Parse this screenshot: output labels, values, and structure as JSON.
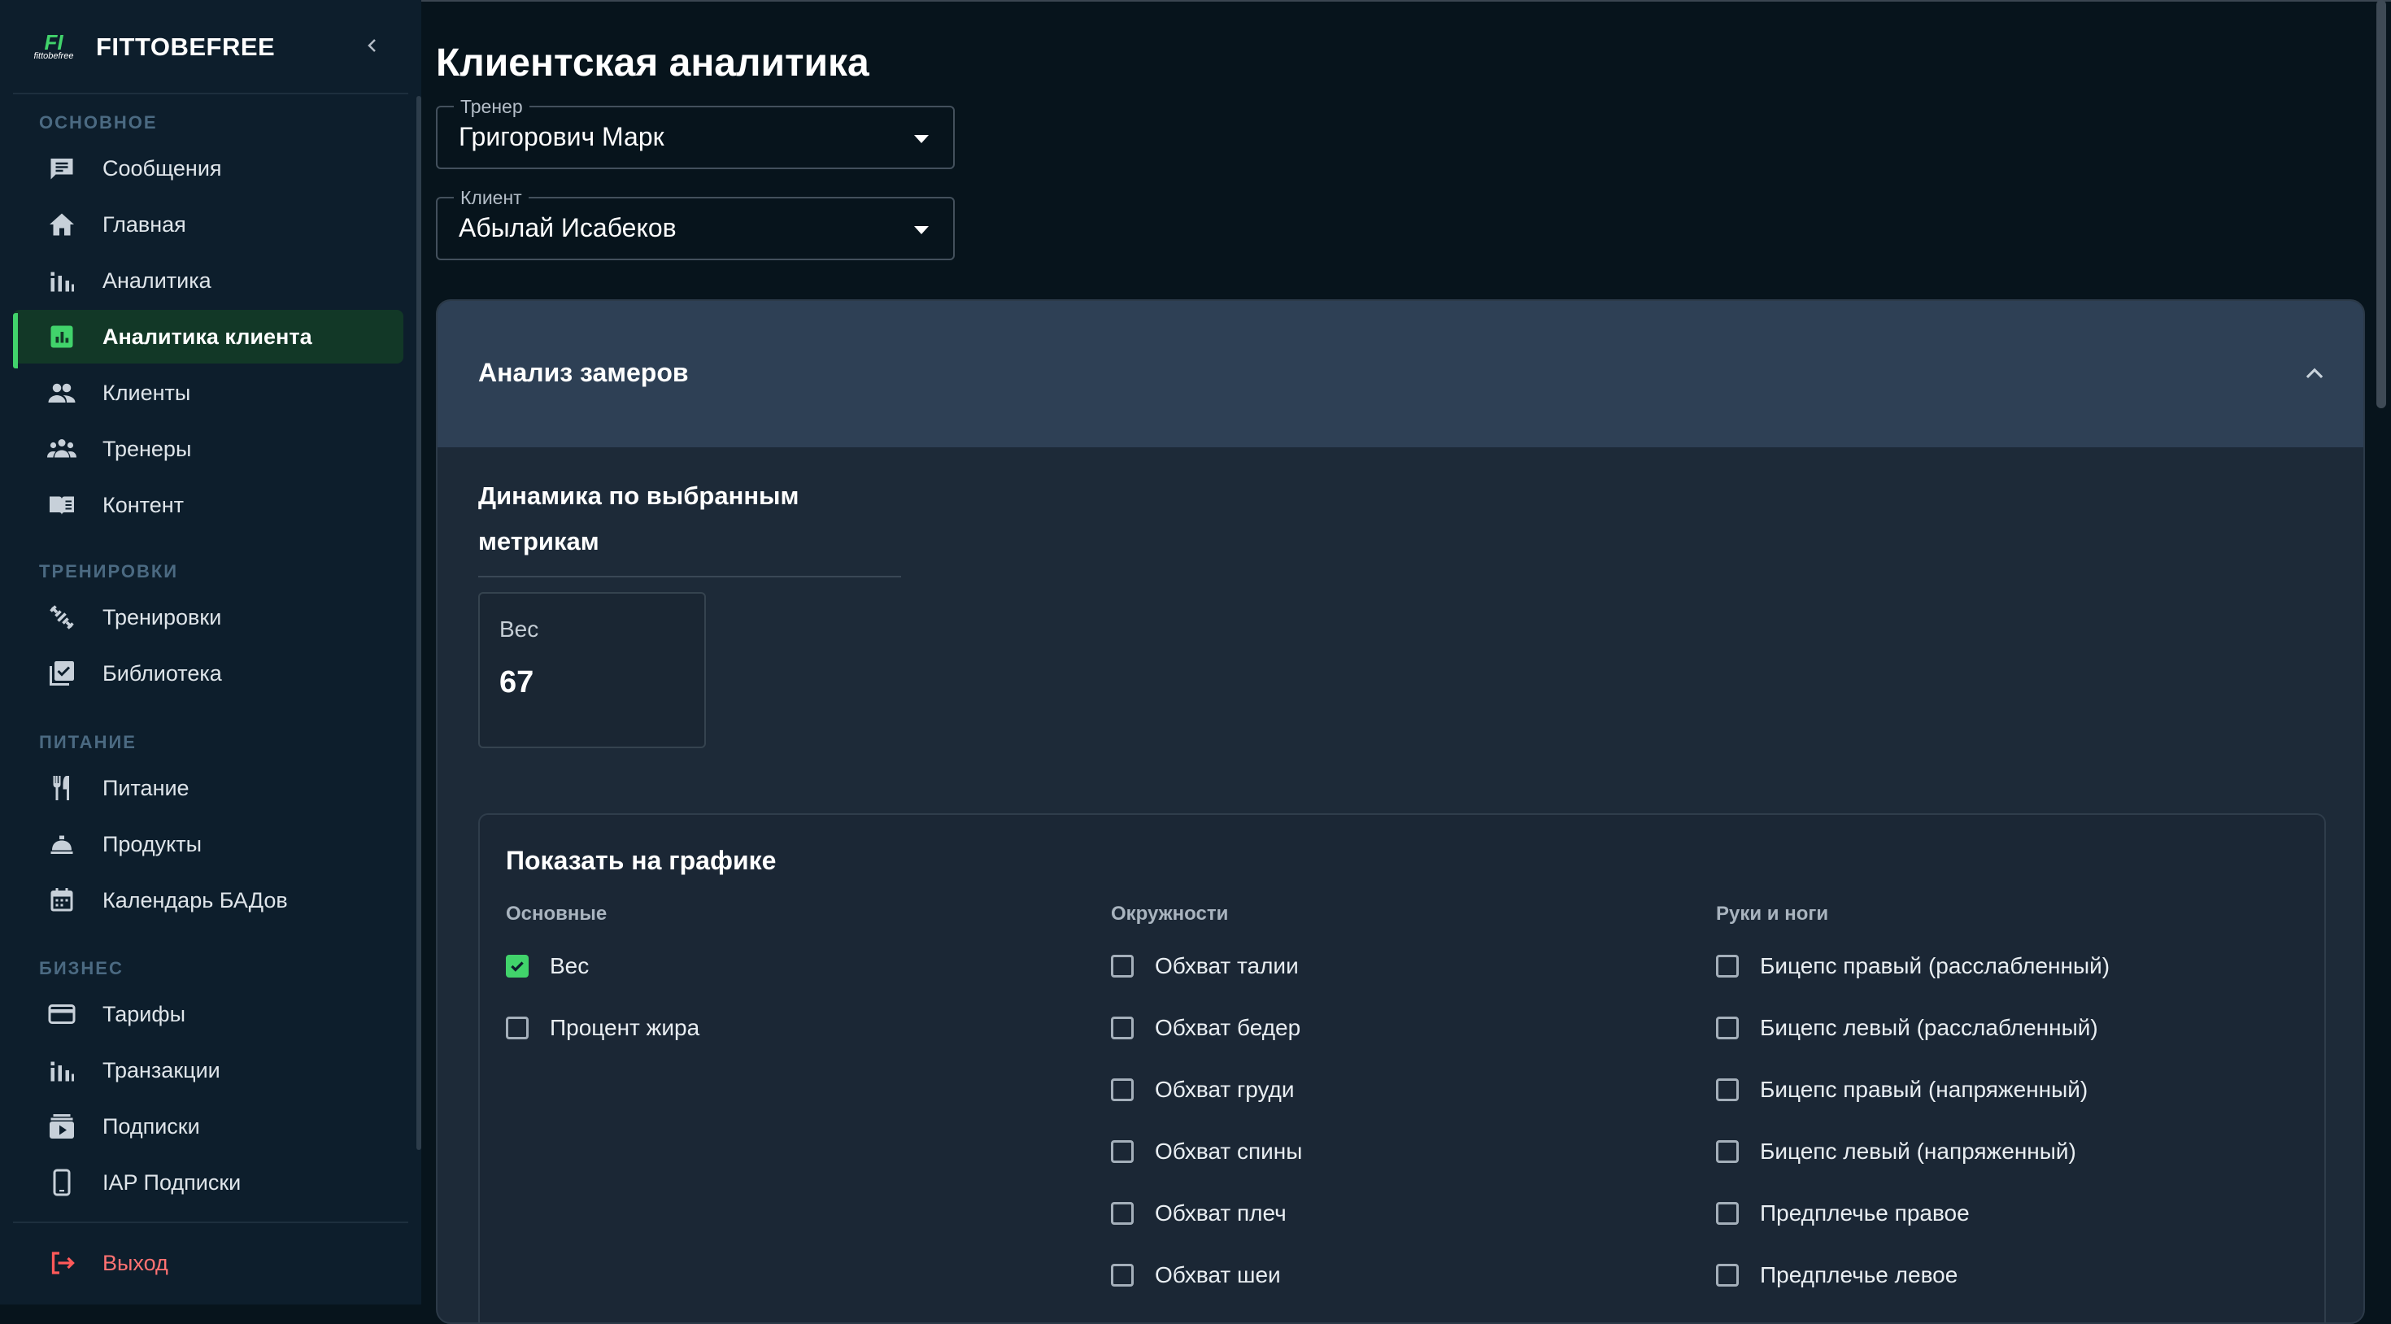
{
  "brand": {
    "logo_mark": "FI",
    "logo_sub": "fittobefree",
    "name": "FITTOBEFREE"
  },
  "sidebar": {
    "sections": [
      {
        "title": "ОСНОВНОЕ",
        "items": [
          {
            "label": "Сообщения",
            "icon": "message-icon"
          },
          {
            "label": "Главная",
            "icon": "home-icon"
          },
          {
            "label": "Аналитика",
            "icon": "bar-chart-icon"
          },
          {
            "label": "Аналитика клиента",
            "icon": "analytics-icon",
            "active": true
          },
          {
            "label": "Клиенты",
            "icon": "people-icon"
          },
          {
            "label": "Тренеры",
            "icon": "groups-icon"
          },
          {
            "label": "Контент",
            "icon": "book-icon"
          }
        ]
      },
      {
        "title": "ТРЕНИРОВКИ",
        "items": [
          {
            "label": "Тренировки",
            "icon": "dumbbell-icon"
          },
          {
            "label": "Библиотека",
            "icon": "library-icon"
          }
        ]
      },
      {
        "title": "ПИТАНИЕ",
        "items": [
          {
            "label": "Питание",
            "icon": "fork-knife-icon"
          },
          {
            "label": "Продукты",
            "icon": "food-icon"
          },
          {
            "label": "Календарь БАДов",
            "icon": "calendar-icon"
          }
        ]
      },
      {
        "title": "БИЗНЕС",
        "items": [
          {
            "label": "Тарифы",
            "icon": "card-icon"
          },
          {
            "label": "Транзакции",
            "icon": "bar-chart-icon"
          },
          {
            "label": "Подписки",
            "icon": "subscriptions-icon"
          },
          {
            "label": "IAP Подписки",
            "icon": "phone-icon"
          }
        ]
      }
    ],
    "logout_label": "Выход"
  },
  "page": {
    "title": "Клиентская аналитика"
  },
  "filters": {
    "trainer": {
      "label": "Тренер",
      "value": "Григорович Марк"
    },
    "client": {
      "label": "Клиент",
      "value": "Абылай Исабеков"
    }
  },
  "card": {
    "title": "Анализ замеров",
    "dynamics_title": "Динамика по выбранным метрикам",
    "metric": {
      "label": "Вес",
      "value": "67"
    },
    "show_title": "Показать на графике",
    "columns": [
      {
        "title": "Основные",
        "items": [
          {
            "label": "Вес",
            "checked": true
          },
          {
            "label": "Процент жира",
            "checked": false
          }
        ]
      },
      {
        "title": "Окружности",
        "items": [
          {
            "label": "Обхват талии",
            "checked": false
          },
          {
            "label": "Обхват бедер",
            "checked": false
          },
          {
            "label": "Обхват груди",
            "checked": false
          },
          {
            "label": "Обхват спины",
            "checked": false
          },
          {
            "label": "Обхват плеч",
            "checked": false
          },
          {
            "label": "Обхват шеи",
            "checked": false
          }
        ]
      },
      {
        "title": "Руки и ноги",
        "items": [
          {
            "label": "Бицепс правый (расслабленный)",
            "checked": false
          },
          {
            "label": "Бицепс левый (расслабленный)",
            "checked": false
          },
          {
            "label": "Бицепс правый (напряженный)",
            "checked": false
          },
          {
            "label": "Бицепс левый (напряженный)",
            "checked": false
          },
          {
            "label": "Предплечье правое",
            "checked": false
          },
          {
            "label": "Предплечье левое",
            "checked": false
          }
        ]
      }
    ]
  },
  "colors": {
    "accent": "#41d36b",
    "logout": "#ff5959",
    "sidebar_bg": "#0d1e2c",
    "page_bg": "#07141c",
    "card_header": "#2e4055"
  }
}
